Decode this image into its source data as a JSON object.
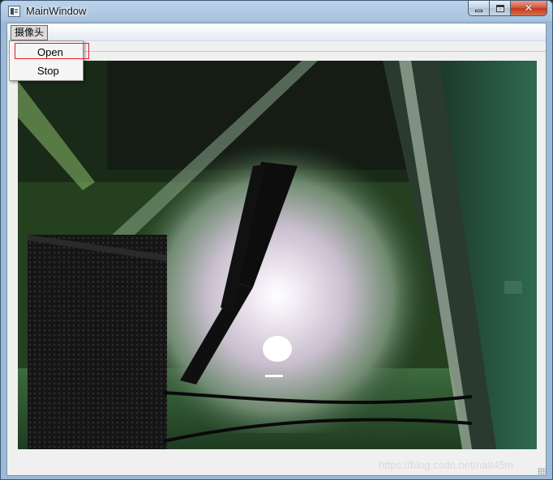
{
  "window": {
    "title": "MainWindow"
  },
  "titlebar_controls": {
    "minimize_icon": "minimize-icon",
    "maximize_icon": "maximize-icon",
    "close_icon": "close-icon",
    "close_glyph": "✕"
  },
  "menubar": {
    "camera_menu_label": "摄像头"
  },
  "camera_menu": {
    "items": [
      {
        "label": "Open"
      },
      {
        "label": "Stop"
      }
    ]
  },
  "watermark": {
    "text": "https://blog.csdn.net/nait45m"
  },
  "colors": {
    "titlebar": "#a9c3de",
    "client_background": "#f0f0f0",
    "highlight_box": "#e02020",
    "close_button": "#c4391c"
  }
}
